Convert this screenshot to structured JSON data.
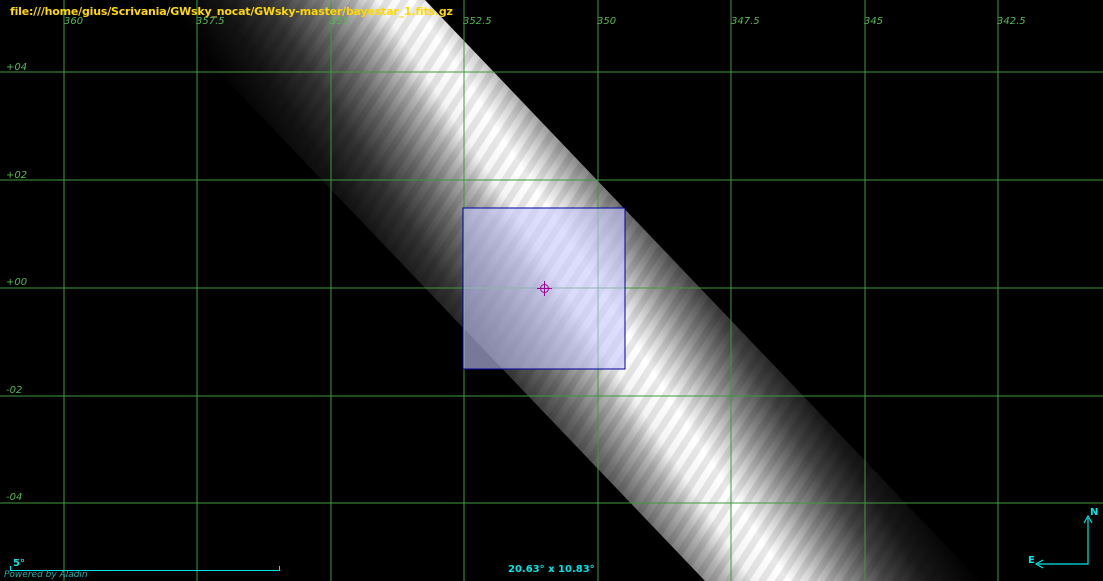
{
  "view": {
    "file_path": "file:///home/gius/Scrivania/GWsky_nocat/GWsky-master/bayestar_1.fits.gz",
    "ra_labels": [
      "360",
      "357.5",
      "355",
      "352.5",
      "350",
      "347.5",
      "345",
      "342.5"
    ],
    "dec_labels": [
      "+04",
      "+02",
      "+00",
      "-02",
      "-04"
    ],
    "scale_label": "5°",
    "fov_label": "20.63° x 10.83°",
    "powered_by": "Powered by Aladin",
    "compass": {
      "north": "N",
      "east": "E"
    }
  },
  "colors": {
    "file_label": "#ffd800",
    "grid": "#3e9a3e",
    "grid_labels": "#55b855",
    "selection_fill": "#c8c8ff",
    "selection_border": "#0000a0",
    "crosshair": "#a000a0",
    "overlay_text": "#00e5e5",
    "powered_by": "#2aa9a9"
  }
}
